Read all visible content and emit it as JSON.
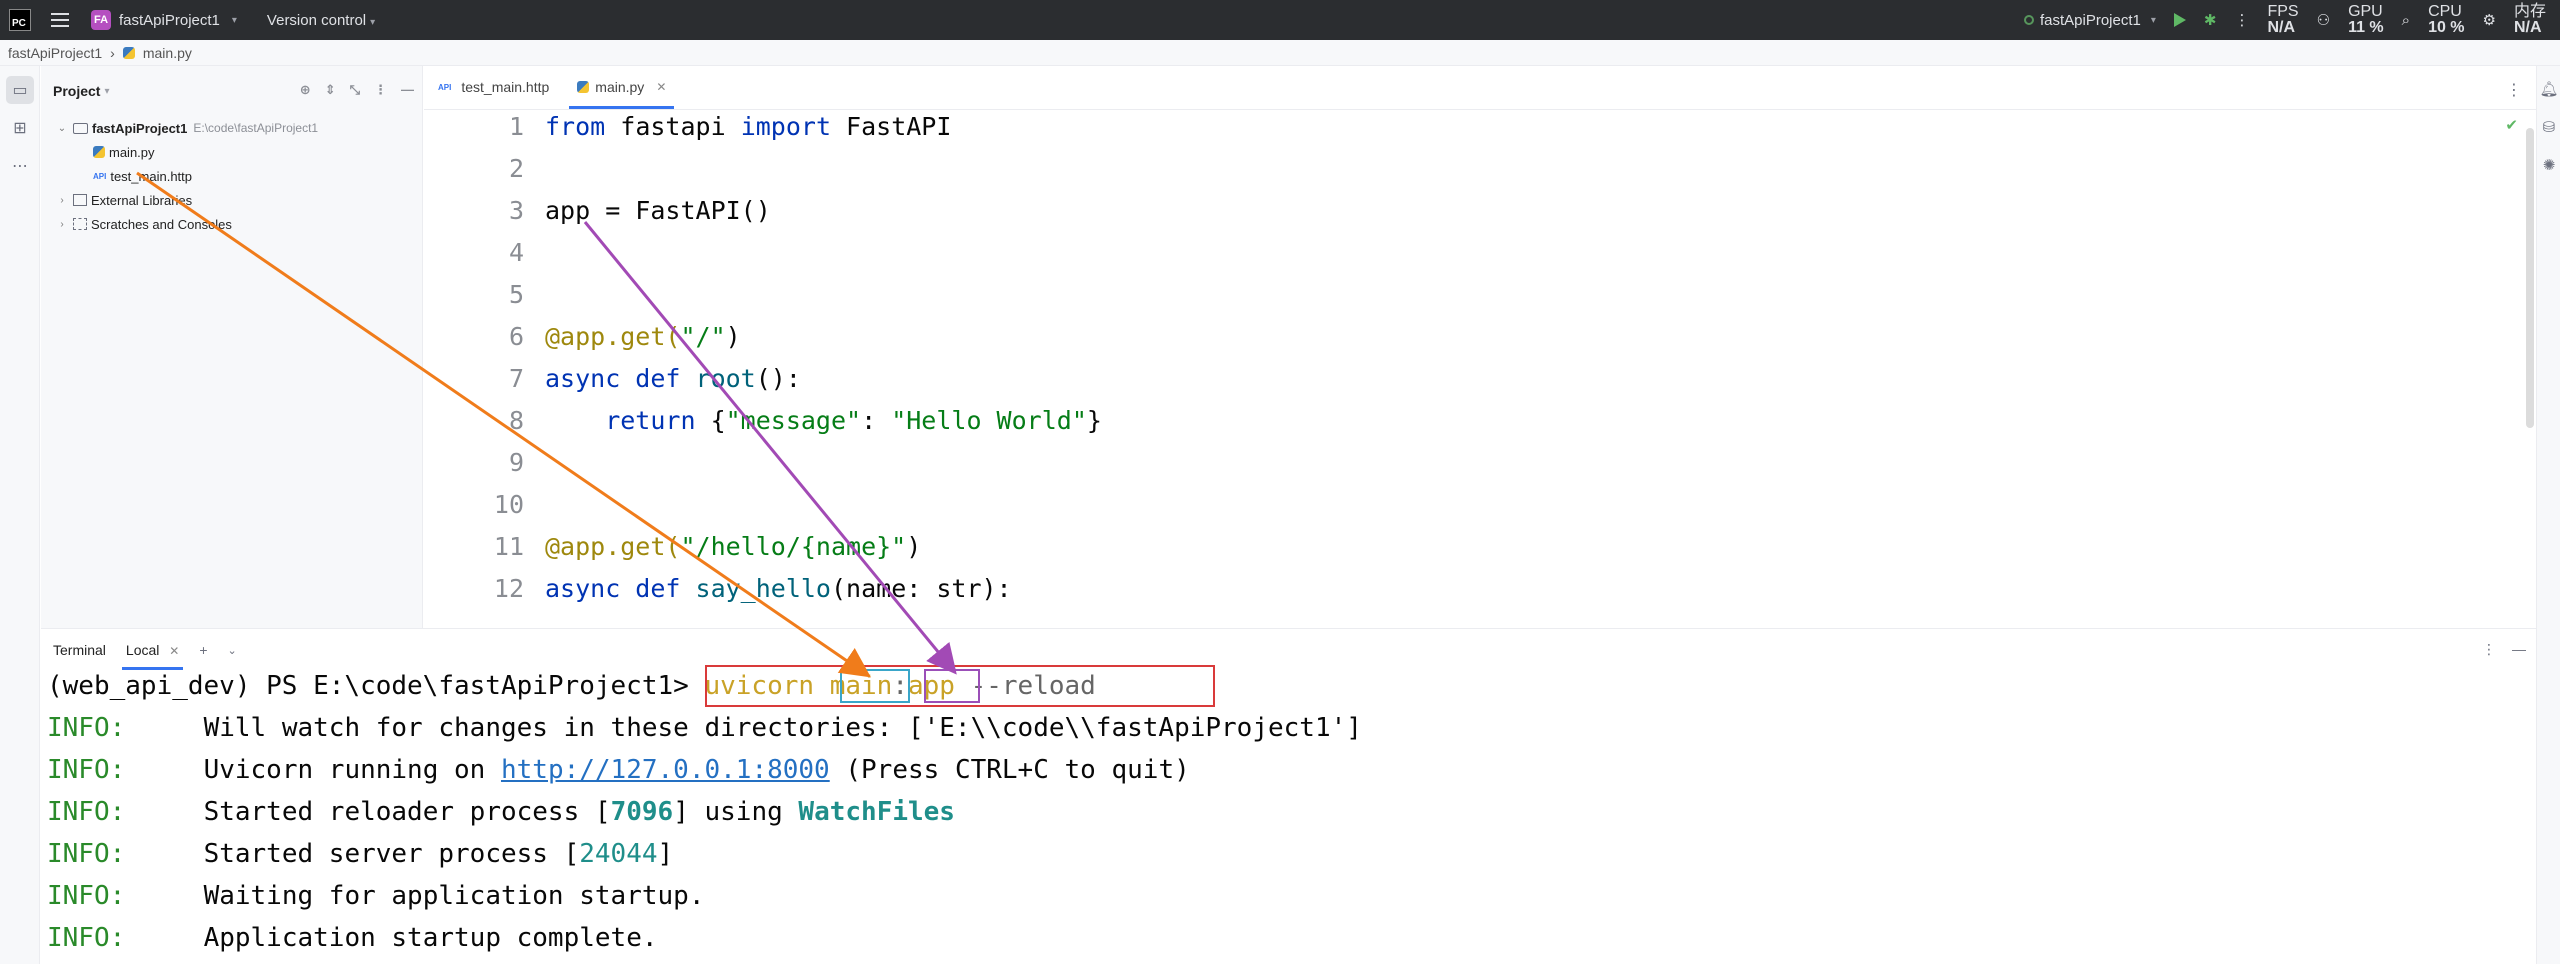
{
  "titlebar": {
    "logo": "PC",
    "project_badge": "FA",
    "project_name": "fastApiProject1",
    "version_control": "Version control",
    "run_config": "fastApiProject1",
    "fps_label": "FPS",
    "fps_value": "N/A",
    "gpu_label": "GPU",
    "gpu_value": "11 %",
    "cpu_label": "CPU",
    "cpu_value": "10 %",
    "mem_label": "内存",
    "mem_value": "N/A"
  },
  "breadcrumb": {
    "project": "fastApiProject1",
    "file": "main.py"
  },
  "project_panel": {
    "title": "Project",
    "root": "fastApiProject1",
    "root_path": "E:\\code\\fastApiProject1",
    "files": [
      "main.py",
      "test_main.http"
    ],
    "external_libraries": "External Libraries",
    "scratches": "Scratches and Consoles"
  },
  "editor": {
    "tabs": [
      {
        "label": "test_main.http",
        "active": false
      },
      {
        "label": "main.py",
        "active": true
      }
    ],
    "line_numbers": [
      "1",
      "2",
      "3",
      "4",
      "5",
      "6",
      "7",
      "8",
      "9",
      "10",
      "11",
      "12"
    ],
    "lines": {
      "l1_kw1": "from",
      "l1_mid": " fastapi ",
      "l1_kw2": "import",
      "l1_end": " FastAPI",
      "l3": "app = FastAPI()",
      "l6_dec": "@app.get(",
      "l6_str": "\"/\"",
      "l6_end": ")",
      "l7_kw": "async def",
      "l7_fn": " root",
      "l7_end": "():",
      "l8_kw": "    return",
      "l8_a": " {",
      "l8_s1": "\"message\"",
      "l8_b": ": ",
      "l8_s2": "\"Hello World\"",
      "l8_c": "}",
      "l11_dec": "@app.get(",
      "l11_str": "\"/hello/{name}\"",
      "l11_end": ")",
      "l12_kw": "async def",
      "l12_fn": " say_hello",
      "l12_end": "(name: str):"
    }
  },
  "terminal": {
    "title": "Terminal",
    "tab_local": "Local",
    "prompt": "(web_api_dev) PS E:\\code\\fastApiProject1>",
    "cmd_uvicorn": "uvicorn",
    "cmd_main": "main",
    "cmd_colon": ":",
    "cmd_app": "app",
    "cmd_reload": " --reload",
    "info_label": "INFO:",
    "lines": {
      "watch": "Will watch for changes in these directories: ['E:\\\\code\\\\fastApiProject1']",
      "running_pre": "Uvicorn running on ",
      "running_url": "http://127.0.0.1:8000",
      "running_post": " (Press CTRL+C to quit)",
      "reloader_pre": "Started reloader process [",
      "reloader_pid": "7096",
      "reloader_mid": "] using ",
      "reloader_tool": "WatchFiles",
      "server_pre": "Started server process [",
      "server_pid": "24044",
      "server_post": "]",
      "waiting": "Waiting for application startup.",
      "complete": "Application startup complete."
    }
  },
  "annotation_colors": {
    "orange_arrow": "#f07c1b",
    "purple_arrow": "#a24ab5",
    "red_box": "#d93a3a",
    "cyan_box": "#3aa6c9",
    "purple_box": "#9b4fb8"
  }
}
